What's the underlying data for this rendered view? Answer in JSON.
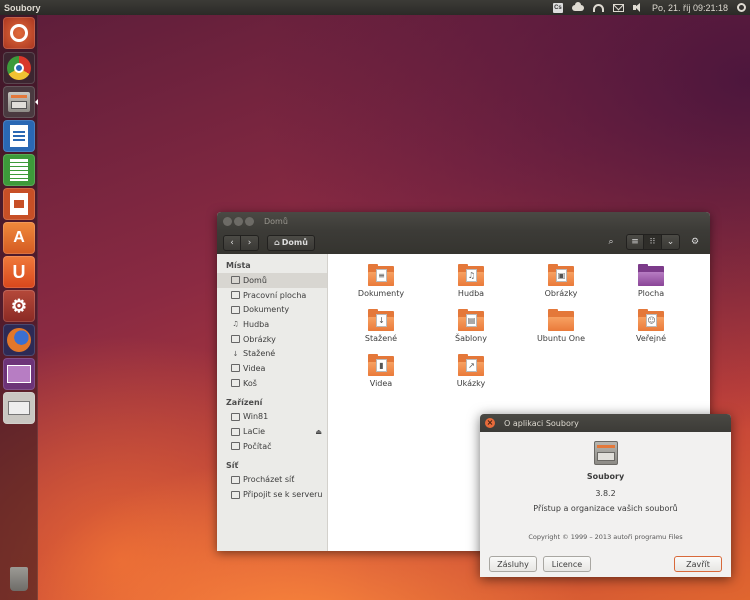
{
  "top_panel": {
    "app_title": "Soubory",
    "indicators": {
      "cs_label": "Cs",
      "clock": "Po, 21. říj 09:21:18"
    }
  },
  "launcher": {
    "items": [
      {
        "name": "ubuntu-dash-icon",
        "color": "#c34a2c"
      },
      {
        "name": "chrome-icon",
        "color": "#d9372a"
      },
      {
        "name": "files-icon",
        "color": "#9e9b94"
      },
      {
        "name": "libreoffice-writer-icon",
        "color": "#2a68b4"
      },
      {
        "name": "libreoffice-calc-icon",
        "color": "#3d9a3a"
      },
      {
        "name": "libreoffice-impress-icon",
        "color": "#c74f26"
      },
      {
        "name": "software-center-icon",
        "color": "#e06a2c"
      },
      {
        "name": "ubuntu-one-icon",
        "color": "#e05a1c"
      },
      {
        "name": "system-settings-icon",
        "color": "#9a3a2e"
      },
      {
        "name": "firefox-icon",
        "color": "#e2772a"
      },
      {
        "name": "workspace-switcher-icon",
        "color": "#7c3b8a"
      },
      {
        "name": "drive-icon",
        "color": "#c9c7c2"
      },
      {
        "name": "trash-icon",
        "color": "#8a8884"
      }
    ]
  },
  "file_manager": {
    "window_title": "Domů",
    "breadcrumb": "Domů",
    "sidebar": {
      "places_header": "Místa",
      "places": [
        {
          "label": "Domů",
          "icon": "home-icon",
          "active": true
        },
        {
          "label": "Pracovní plocha",
          "icon": "desktop-icon"
        },
        {
          "label": "Dokumenty",
          "icon": "documents-icon"
        },
        {
          "label": "Hudba",
          "icon": "music-icon"
        },
        {
          "label": "Obrázky",
          "icon": "camera-icon"
        },
        {
          "label": "Stažené",
          "icon": "download-icon"
        },
        {
          "label": "Videa",
          "icon": "video-icon"
        },
        {
          "label": "Koš",
          "icon": "trash-icon"
        }
      ],
      "devices_header": "Zařízení",
      "devices": [
        {
          "label": "Win81",
          "icon": "drive-icon"
        },
        {
          "label": "LaCie",
          "icon": "drive-icon",
          "eject": true
        },
        {
          "label": "Počítač",
          "icon": "computer-icon"
        }
      ],
      "network_header": "Síť",
      "network": [
        {
          "label": "Procházet síť",
          "icon": "network-icon"
        },
        {
          "label": "Připojit se k serveru",
          "icon": "server-icon"
        }
      ]
    },
    "folders": [
      {
        "label": "Dokumenty",
        "emblem": "≡",
        "purple": false
      },
      {
        "label": "Hudba",
        "emblem": "♫",
        "purple": false
      },
      {
        "label": "Obrázky",
        "emblem": "▣",
        "purple": false
      },
      {
        "label": "Plocha",
        "emblem": "",
        "purple": true
      },
      {
        "label": "Stažené",
        "emblem": "↓",
        "purple": false
      },
      {
        "label": "Šablony",
        "emblem": "▤",
        "purple": false
      },
      {
        "label": "Ubuntu One",
        "emblem": "",
        "purple": false
      },
      {
        "label": "Veřejné",
        "emblem": "☺",
        "purple": false
      },
      {
        "label": "Videa",
        "emblem": "▮",
        "purple": false
      },
      {
        "label": "Ukázky",
        "emblem": "↗",
        "purple": false
      }
    ]
  },
  "about_dialog": {
    "title": "O aplikaci Soubory",
    "app_name": "Soubory",
    "version": "3.8.2",
    "description": "Přístup a organizace vašich souborů",
    "copyright": "Copyright © 1999 – 2013 autoři programu Files",
    "buttons": {
      "credits": "Zásluhy",
      "license": "Licence",
      "close": "Zavřít"
    }
  }
}
